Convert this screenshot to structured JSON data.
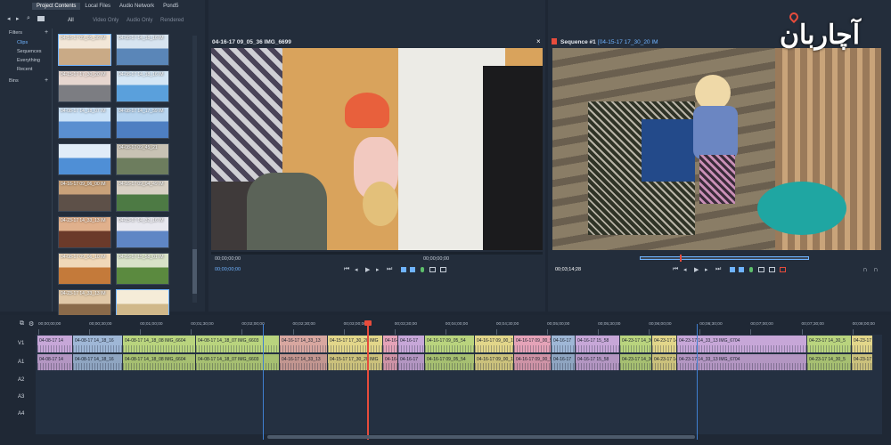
{
  "library": {
    "tabs": [
      "Project Contents",
      "Local Files",
      "Audio Network",
      "Pond5"
    ],
    "filters_label": "Filters",
    "filter_items": [
      "Clips",
      "Sequences",
      "Everything",
      "Recent"
    ],
    "bins_label": "Bins",
    "type_filters": [
      "All",
      "Video Only",
      "Audio Only",
      "Rendered"
    ],
    "thumbnails": [
      "04-16-17 09_05_36 IM",
      "04-08-17 14_18_16 IM",
      "04-15-17 17_30_20 IM",
      "04-08-17 14_18_16 IM",
      "04-08-17 14_18_07 IM",
      "04-08-17 14_17_59 IM",
      "",
      "04-08-17 09_45_21",
      "04-16-17 09_06_00 IM",
      "04-16-17 09_04_49 IM",
      "04-23-17 14_33_13 IM",
      "04-23-17 14_32_16 IM",
      "04-08-17 09_06_10 IM",
      "04-16-17 15_58_01 IM",
      "04-23-17 14_33_13 IM",
      ""
    ]
  },
  "source_viewer": {
    "title": "04-16-17 09_05_36 IMG_6699",
    "close": "×",
    "tc_start": "00;00;00;00",
    "tc_end": "00;00;00;00",
    "current_tc": "00;00;00;00"
  },
  "record_viewer": {
    "title": "Sequence #1",
    "subtitle": "[04-15-17 17_30_20 IM",
    "current_tc": "00;03;14;28"
  },
  "timeline": {
    "ruler": [
      "00;00;00;00",
      "00;00;30;00",
      "00;01;00;00",
      "00;01;30;00",
      "00;02;00;00",
      "00;02;30;00",
      "00;03;00;00",
      "00;03;30;00",
      "00;04;00;00",
      "00;04;30;00",
      "00;05;00;00",
      "00;05;30;00",
      "00;06;00;00",
      "00;06;30;00",
      "00;07;00;00",
      "00;07;30;00",
      "00;08;00;00"
    ],
    "tracks": [
      "V1",
      "A1",
      "A2",
      "A3",
      "A4"
    ],
    "clips": [
      {
        "label": "04-08-17 14",
        "color": "#c7a7d8"
      },
      {
        "label": "04-08-17 14_18_16",
        "color": "#9fb7d6"
      },
      {
        "label": "04-08-17 14_18_08 IMG_6604",
        "color": "#b9d47e"
      },
      {
        "label": "04-08-17 14_18_07 IMG_6603",
        "color": "#b9d47e"
      },
      {
        "label": "04-16-17 14_33_13",
        "color": "#d8a7a0"
      },
      {
        "label": "04-15-17 17_30_20 IMG",
        "color": "#e2d68a"
      },
      {
        "label": "04-16-17 09_00_54",
        "color": "#e5a3b8"
      },
      {
        "label": "04-16-17",
        "color": "#c7a7d8"
      },
      {
        "label": "04-16-17 09_05_54",
        "color": "#b9d47e"
      },
      {
        "label": "04-16-17 09_00_17",
        "color": "#e2d68a"
      },
      {
        "label": "04-16-17 09_00_53",
        "color": "#e5a3b8"
      },
      {
        "label": "04-16-17",
        "color": "#9fb7d6"
      },
      {
        "label": "04-16-17 15_58",
        "color": "#c7a7d8"
      },
      {
        "label": "04-23-17 14_30_54",
        "color": "#b9d47e"
      },
      {
        "label": "04-23-17 14",
        "color": "#e2d68a"
      },
      {
        "label": "04-23-17 14_33_13 IMG_6704",
        "color": "#c7a7d8"
      },
      {
        "label": "04-23-17 14_30_5",
        "color": "#b9d47e"
      },
      {
        "label": "04-23-17",
        "color": "#e2d68a"
      }
    ]
  },
  "logo_text": "آچاربان",
  "colors": {
    "accent": "#e74c3c",
    "panel": "#232d3b",
    "background": "#1e2734"
  }
}
